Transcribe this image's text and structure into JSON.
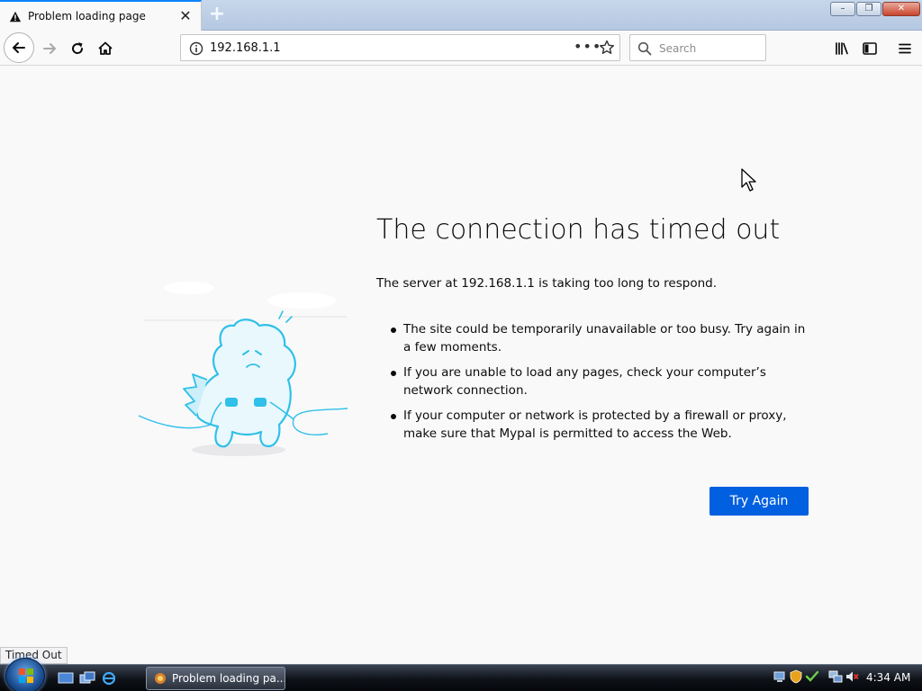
{
  "browser": {
    "tab": {
      "title": "Problem loading page",
      "icon": "warning-icon",
      "close_glyph": "✕"
    },
    "new_tab_glyph": "+",
    "window_buttons": {
      "minimize": "–",
      "restore": "❐",
      "close": "✕"
    },
    "nav": {
      "back": "back-arrow-icon",
      "forward": "forward-arrow-icon",
      "reload": "reload-icon",
      "home": "home-icon"
    },
    "url": {
      "value": "192.168.1.1",
      "page_actions_glyph": "•••"
    },
    "search": {
      "placeholder": "Search"
    },
    "toolbar_icons": [
      "library-icon",
      "sidebar-icon",
      "menu-icon"
    ]
  },
  "error": {
    "title": "The connection has timed out",
    "lead": "The server at 192.168.1.1 is taking too long to respond.",
    "items": [
      "The site could be temporarily unavailable or too busy. Try again in a few moments.",
      "If you are unable to load any pages, check your computer’s network connection.",
      "If your computer or network is protected by a firewall or proxy, make sure that Mypal is permitted to access the Web."
    ],
    "button": "Try Again"
  },
  "status_text": "Timed Out",
  "taskbar": {
    "window_item": "Problem loading pa...",
    "clock": "4:34 AM"
  },
  "colors": {
    "accent": "#0a84ff",
    "button": "#0060df",
    "page_bg": "#f9f9fa",
    "illustration": "#30c0e8"
  }
}
